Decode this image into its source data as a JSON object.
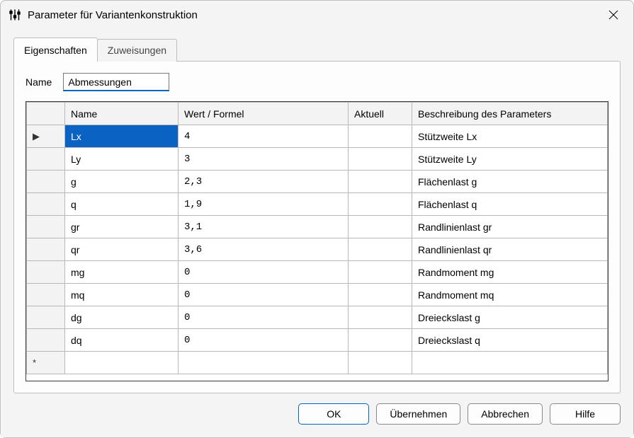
{
  "window": {
    "title": "Parameter für Variantenkonstruktion"
  },
  "tabs": {
    "properties": "Eigenschaften",
    "assignments": "Zuweisungen"
  },
  "name_field": {
    "label": "Name",
    "value": "Abmessungen"
  },
  "grid": {
    "headers": {
      "marker": "",
      "name": "Name",
      "value": "Wert / Formel",
      "actual": "Aktuell",
      "desc": "Beschreibung des Parameters"
    },
    "rows": [
      {
        "marker": "▶",
        "name": "Lx",
        "value": "4",
        "actual": "",
        "desc": "Stützweite Lx",
        "selected": true
      },
      {
        "marker": "",
        "name": "Ly",
        "value": "3",
        "actual": "",
        "desc": "Stützweite Ly",
        "selected": false
      },
      {
        "marker": "",
        "name": "g",
        "value": "2,3",
        "actual": "",
        "desc": "Flächenlast g",
        "selected": false
      },
      {
        "marker": "",
        "name": "q",
        "value": "1,9",
        "actual": "",
        "desc": "Flächenlast q",
        "selected": false
      },
      {
        "marker": "",
        "name": "gr",
        "value": "3,1",
        "actual": "",
        "desc": "Randlinienlast gr",
        "selected": false
      },
      {
        "marker": "",
        "name": "qr",
        "value": "3,6",
        "actual": "",
        "desc": "Randlinienlast qr",
        "selected": false
      },
      {
        "marker": "",
        "name": "mg",
        "value": "0",
        "actual": "",
        "desc": "Randmoment mg",
        "selected": false
      },
      {
        "marker": "",
        "name": "mq",
        "value": "0",
        "actual": "",
        "desc": "Randmoment mq",
        "selected": false
      },
      {
        "marker": "",
        "name": "dg",
        "value": "0",
        "actual": "",
        "desc": "Dreieckslast g",
        "selected": false
      },
      {
        "marker": "",
        "name": "dq",
        "value": "0",
        "actual": "",
        "desc": "Dreieckslast q",
        "selected": false
      },
      {
        "marker": "*",
        "name": "",
        "value": "",
        "actual": "",
        "desc": "",
        "selected": false
      }
    ]
  },
  "buttons": {
    "ok": "OK",
    "apply": "Übernehmen",
    "cancel": "Abbrechen",
    "help": "Hilfe"
  }
}
